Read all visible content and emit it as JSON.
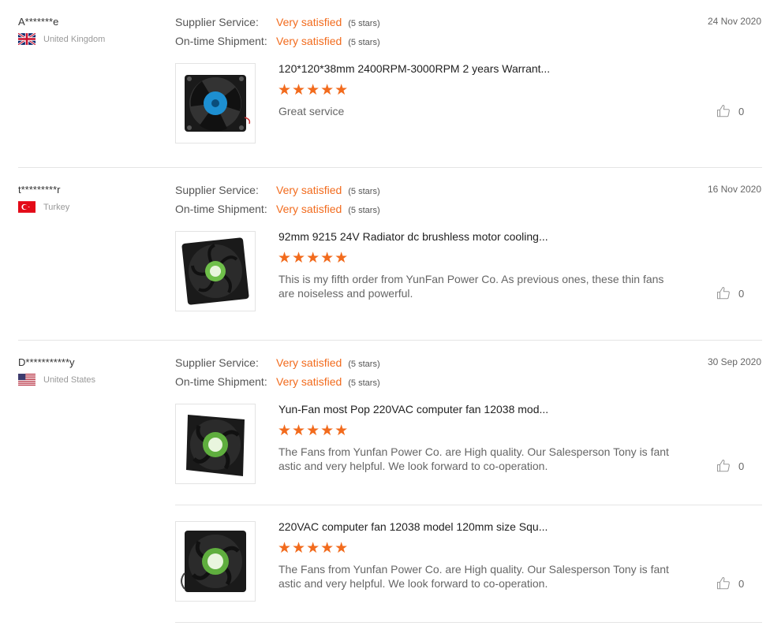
{
  "labels": {
    "supplier_service": "Supplier Service:",
    "ontime_shipment": "On-time Shipment:"
  },
  "reviews": [
    {
      "name": "A*******e",
      "country": "United Kingdom",
      "flag": "uk-flag",
      "date": "24 Nov 2020",
      "supplier_value": "Very satisfied",
      "supplier_stars": "(5 stars)",
      "shipment_value": "Very satisfied",
      "shipment_stars": "(5 stars)",
      "products": [
        {
          "title": "120*120*38mm 2400RPM-3000RPM 2 years Warrant...",
          "rating": 5,
          "stars": "★★★★★",
          "comment": "Great service",
          "likes": "0",
          "thumb": "fan-blue-label"
        }
      ]
    },
    {
      "name": "t*********r",
      "country": "Turkey",
      "flag": "turkey-flag",
      "date": "16 Nov 2020",
      "supplier_value": "Very satisfied",
      "supplier_stars": "(5 stars)",
      "shipment_value": "Very satisfied",
      "shipment_stars": "(5 stars)",
      "products": [
        {
          "title": "92mm 9215 24V Radiator dc brushless motor cooling...",
          "rating": 5,
          "stars": "★★★★★",
          "comment": "This is my fifth order from YunFan Power Co.  As previous ones, these thin fans are noiseless and powerful.",
          "likes": "0",
          "thumb": "fan-green-label"
        }
      ]
    },
    {
      "name": "D***********y",
      "country": "United States",
      "flag": "us-flag",
      "date": "30 Sep 2020",
      "supplier_value": "Very satisfied",
      "supplier_stars": "(5 stars)",
      "shipment_value": "Very satisfied",
      "shipment_stars": "(5 stars)",
      "products": [
        {
          "title": "Yun-Fan most Pop 220VAC computer fan 12038 mod...",
          "rating": 5,
          "stars": "★★★★★",
          "comment": "The Fans from Yunfan Power Co. are High quality. Our Salesperson Tony is fantastic and very helpful. We look forward to co-operation.",
          "likes": "0",
          "thumb": "fan-green-label"
        },
        {
          "title": "220VAC computer fan 12038 model 120mm size Squ...",
          "rating": 5,
          "stars": "★★★★★",
          "comment": "The Fans from Yunfan Power Co. are High quality. Our Salesperson Tony is fantastic and very helpful. We look forward to co-operation.",
          "likes": "0",
          "thumb": "fan-green-label"
        }
      ]
    }
  ],
  "colors": {
    "accent": "#f26b1d",
    "divider": "#e5e5e5"
  }
}
